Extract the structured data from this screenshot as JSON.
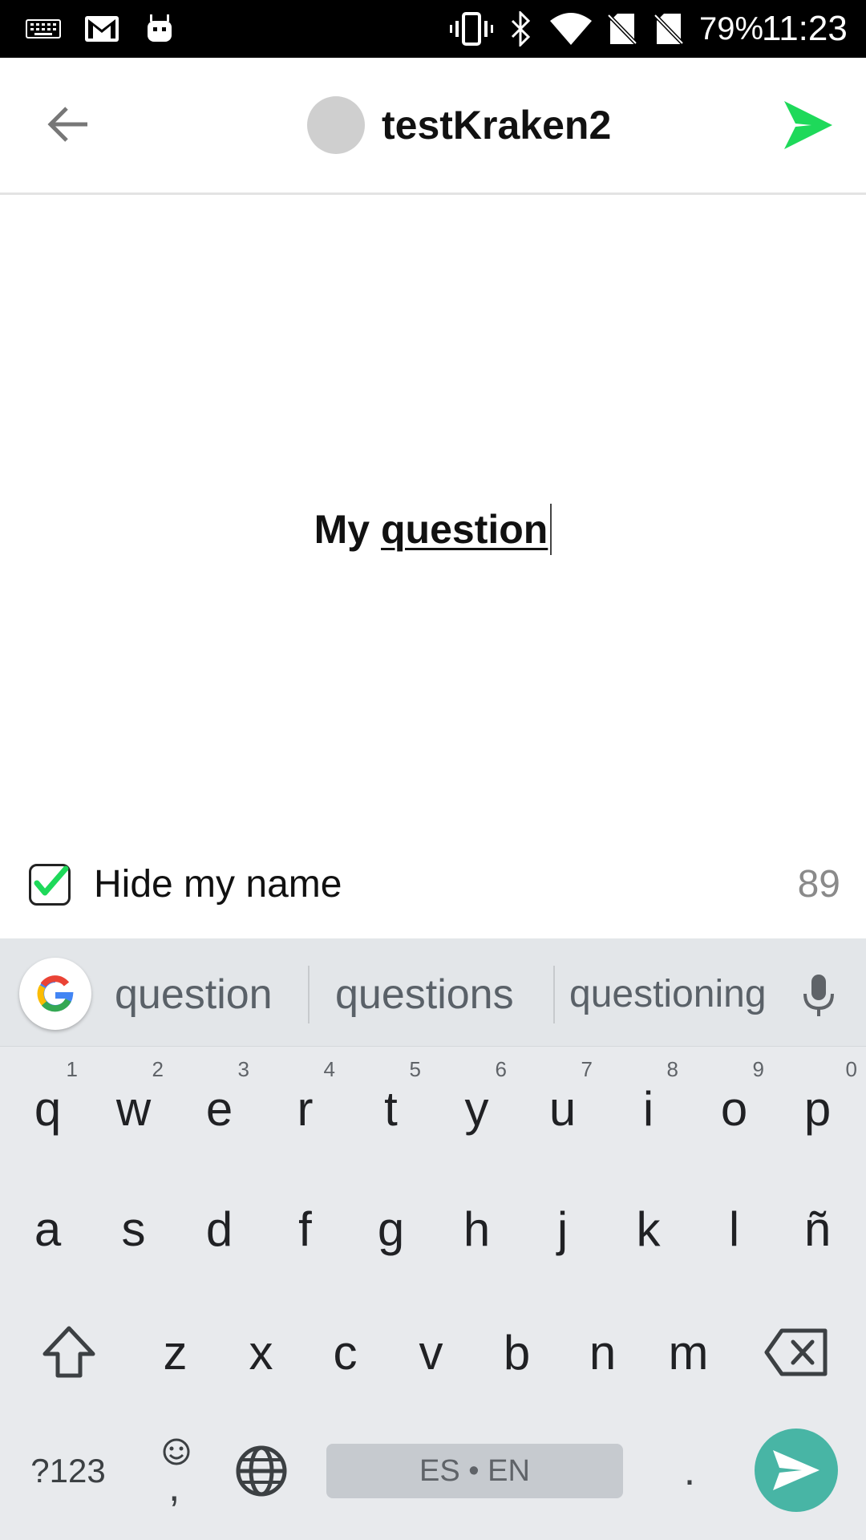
{
  "status_bar": {
    "battery": "79%",
    "time": "11:23",
    "icons": [
      "keyboard-icon",
      "gmail-icon",
      "android-icon",
      "vibrate-icon",
      "bluetooth-icon",
      "wifi-icon",
      "no-sim-icon",
      "no-sim-icon"
    ]
  },
  "header": {
    "username": "testKraken2",
    "accent_color": "#1ed95a",
    "icons": {
      "back": "arrow-left-icon",
      "send": "send-icon"
    }
  },
  "compose": {
    "question_prefix": "My ",
    "question_word": "question",
    "hide_name_label": "Hide my name",
    "hide_name_checked": true,
    "char_count": "89"
  },
  "keyboard": {
    "suggestions": [
      "question",
      "questions",
      "questioning"
    ],
    "row1": [
      {
        "k": "q",
        "n": "1"
      },
      {
        "k": "w",
        "n": "2"
      },
      {
        "k": "e",
        "n": "3"
      },
      {
        "k": "r",
        "n": "4"
      },
      {
        "k": "t",
        "n": "5"
      },
      {
        "k": "y",
        "n": "6"
      },
      {
        "k": "u",
        "n": "7"
      },
      {
        "k": "i",
        "n": "8"
      },
      {
        "k": "o",
        "n": "9"
      },
      {
        "k": "p",
        "n": "0"
      }
    ],
    "row2": [
      "a",
      "s",
      "d",
      "f",
      "g",
      "h",
      "j",
      "k",
      "l",
      "ñ"
    ],
    "row3": [
      "z",
      "x",
      "c",
      "v",
      "b",
      "n",
      "m"
    ],
    "symbols_label": "?123",
    "comma_label": ",",
    "period_label": ".",
    "space_label": "ES • EN",
    "enter_color": "#48b5a5"
  }
}
